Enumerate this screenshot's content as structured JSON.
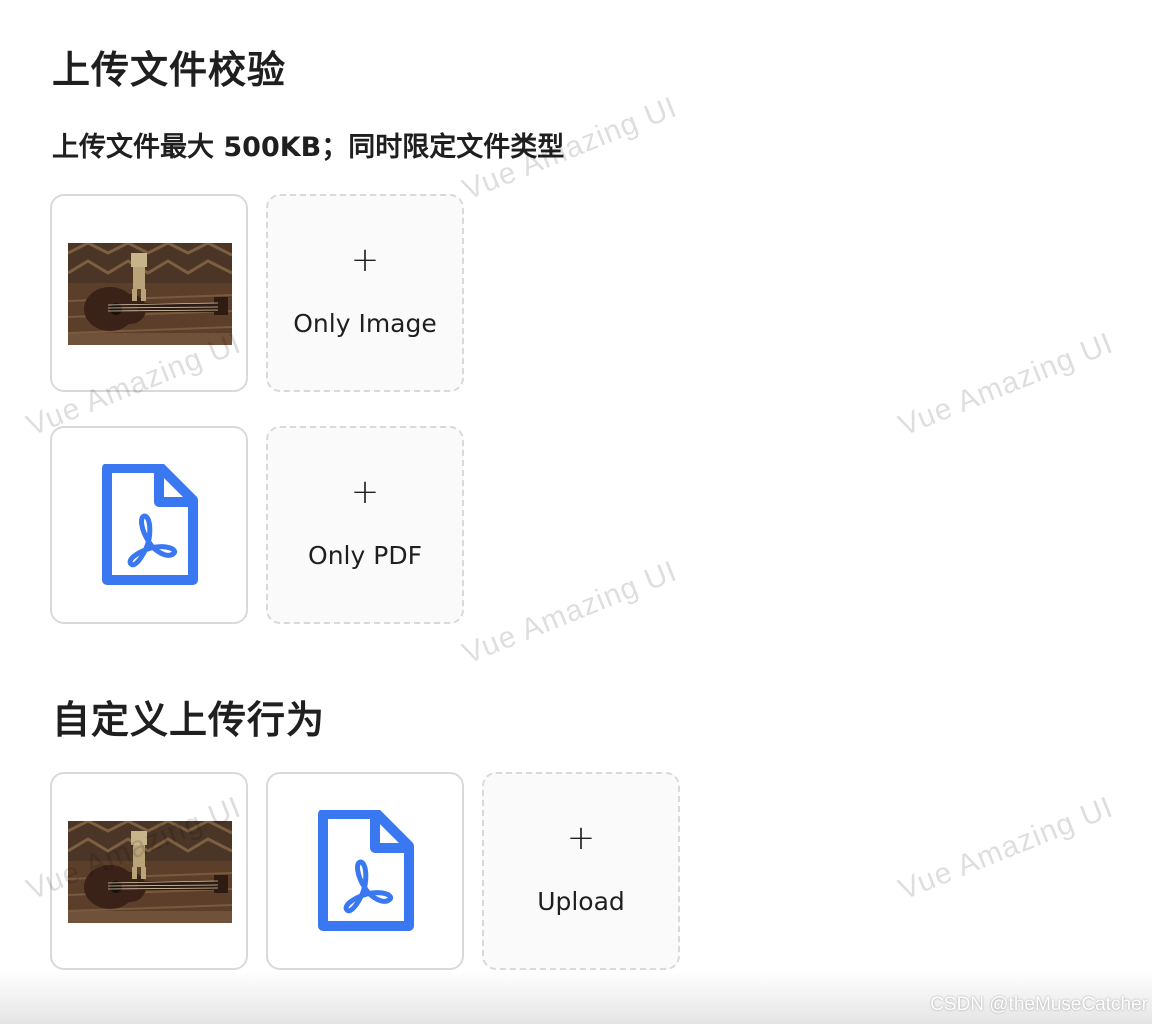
{
  "section1": {
    "title": "上传文件校验",
    "subtitle": "上传文件最大 500KB；同时限定文件类型",
    "image_trigger_label": "Only Image",
    "pdf_trigger_label": "Only PDF"
  },
  "section2": {
    "title": "自定义上传行为",
    "trigger_label": "Upload"
  },
  "icons": {
    "plus": "+",
    "pdf_color": "#3a78f2"
  },
  "watermark": {
    "text": "Vue Amazing UI"
  },
  "footer": {
    "credit": "CSDN @theMuseCatcher"
  }
}
